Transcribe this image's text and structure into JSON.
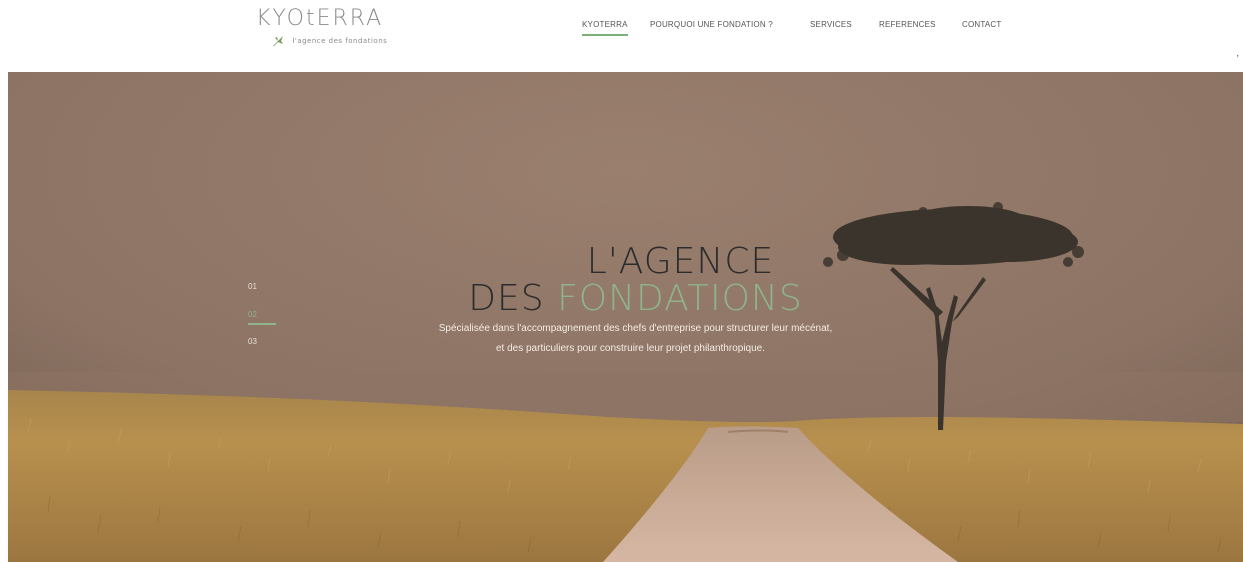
{
  "brand": {
    "name": "KYOtERRA",
    "tagline": "l'agence des fondations",
    "accent_color": "#7bb07a"
  },
  "nav": {
    "items": [
      {
        "label": "KYOTERRA",
        "active": true
      },
      {
        "label": "POURQUOI UNE FONDATION ?",
        "active": false
      },
      {
        "label": "SERVICES",
        "active": false
      },
      {
        "label": "REFERENCES",
        "active": false
      },
      {
        "label": "CONTACT",
        "active": false
      }
    ]
  },
  "edge_mark": ",",
  "hero": {
    "title_line1": "L'agence",
    "title_line2_a": "DES",
    "title_line2_b": "FONDATIONS",
    "subtitle_line1": "Spécialisée dans l'accompagnement des chefs d'entreprise pour structurer leur mécénat,",
    "subtitle_line2": "et des particuliers pour construire leur projet philanthropique.",
    "slides": [
      "01",
      "02",
      "03"
    ],
    "active_slide": "02"
  }
}
